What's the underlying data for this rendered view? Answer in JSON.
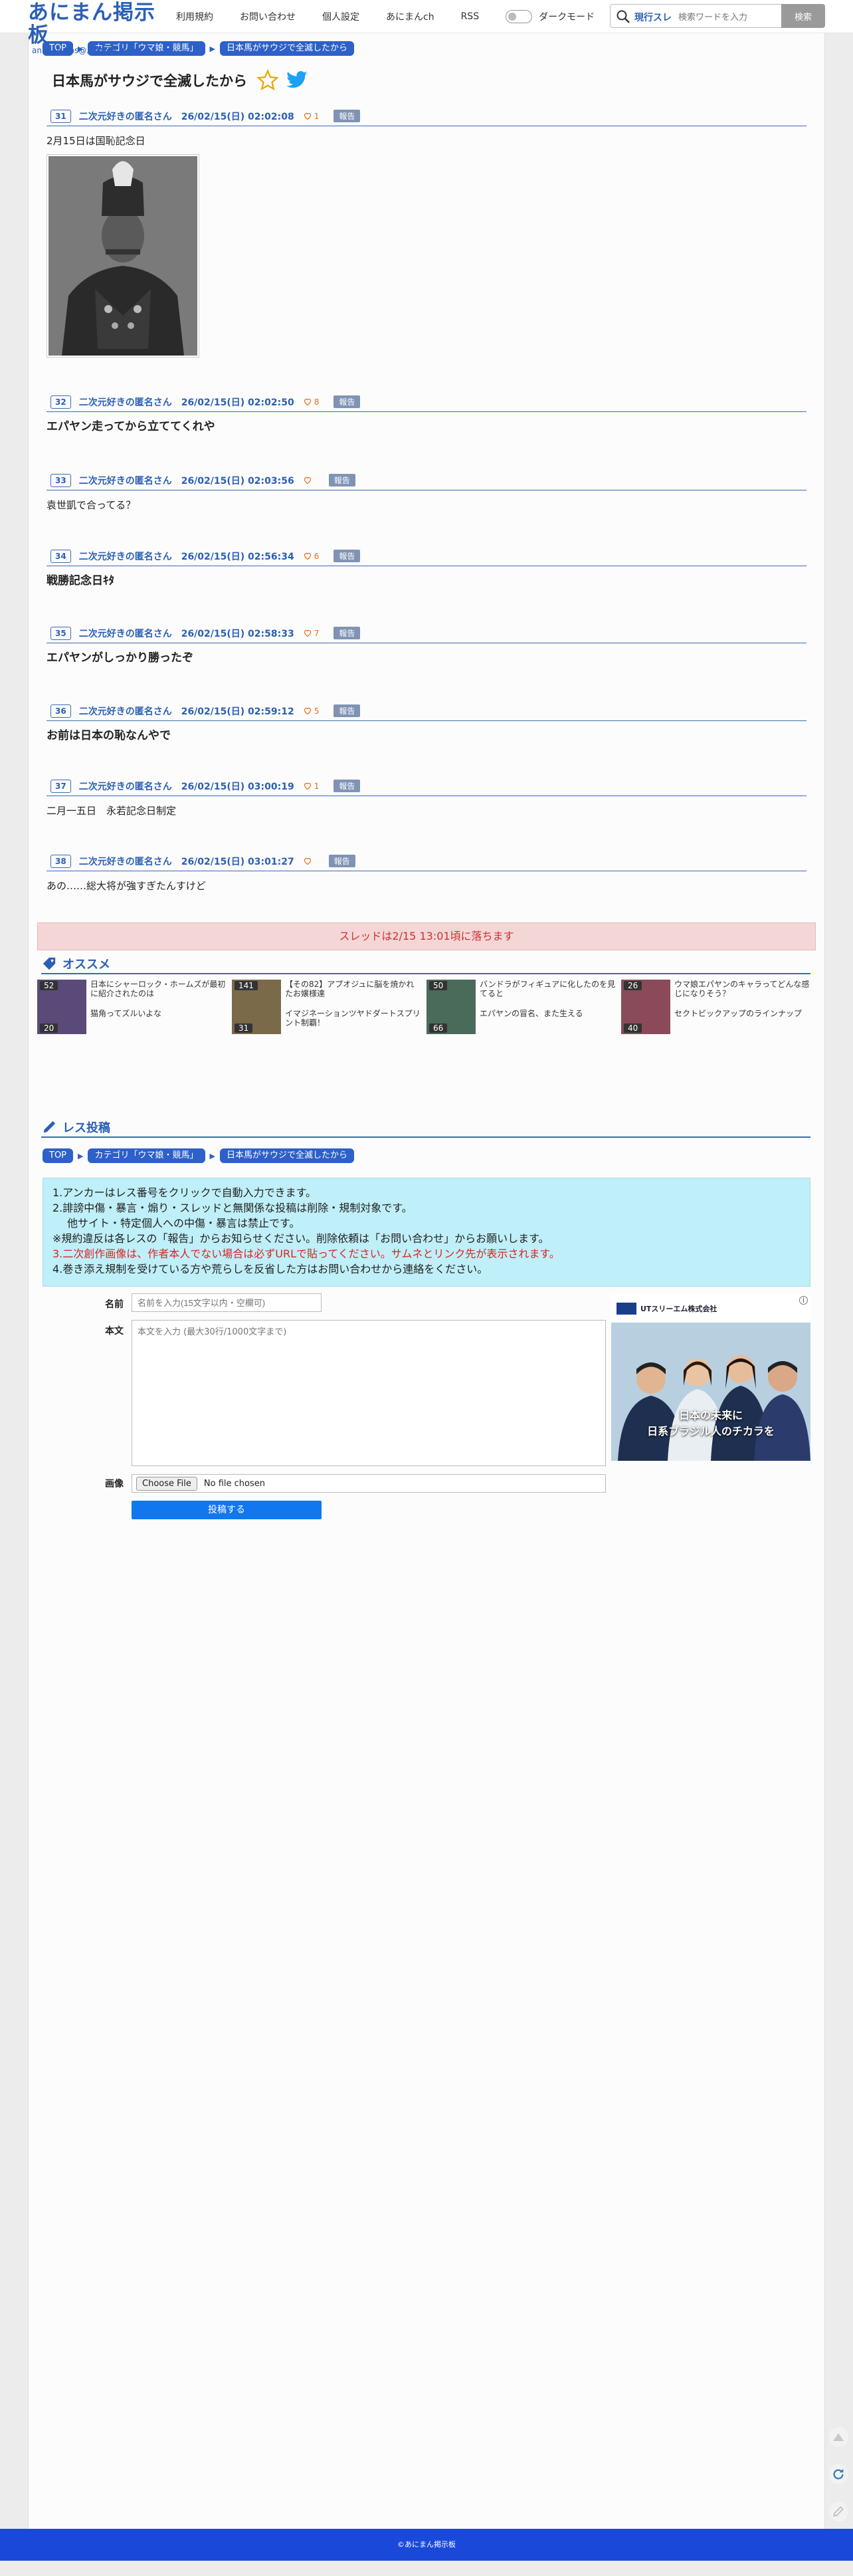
{
  "header": {
    "logo_main": "あにまん掲示板",
    "logo_sub": "animan bbs@二次元オンリー",
    "nav": [
      "利用規約",
      "お問い合わせ",
      "個人設定",
      "あにまんch",
      "RSS"
    ],
    "dark_mode_label": "ダークモード",
    "search_mode": "現行スレ",
    "search_placeholder": "検索ワードを入力",
    "search_button": "検索"
  },
  "breadcrumb": {
    "top": "TOP",
    "category": "カテゴリ「ウマ娘・競馬」",
    "thread": "日本馬がサウジで全滅したから"
  },
  "thread": {
    "title": "日本馬がサウジで全滅したから"
  },
  "posts": [
    {
      "no": "31",
      "name": "二次元好きの匿名さん",
      "date": "26/02/15(日) 02:02:08",
      "likes": "1",
      "report": "報告",
      "body": "2月15日は国恥記念日",
      "has_image": true
    },
    {
      "no": "32",
      "name": "二次元好きの匿名さん",
      "date": "26/02/15(日) 02:02:50",
      "likes": "8",
      "report": "報告",
      "body": "エパヤン走ってから立ててくれや"
    },
    {
      "no": "33",
      "name": "二次元好きの匿名さん",
      "date": "26/02/15(日) 02:03:56",
      "likes": "",
      "report": "報告",
      "body": "袁世凱で合ってる？"
    },
    {
      "no": "34",
      "name": "二次元好きの匿名さん",
      "date": "26/02/15(日) 02:56:34",
      "likes": "6",
      "report": "報告",
      "body": "戦勝記念日ｷﾀ"
    },
    {
      "no": "35",
      "name": "二次元好きの匿名さん",
      "date": "26/02/15(日) 02:58:33",
      "likes": "7",
      "report": "報告",
      "body": "エパヤンがしっかり勝ったぞ"
    },
    {
      "no": "36",
      "name": "二次元好きの匿名さん",
      "date": "26/02/15(日) 02:59:12",
      "likes": "5",
      "report": "報告",
      "body": "お前は日本の恥なんやで"
    },
    {
      "no": "37",
      "name": "二次元好きの匿名さん",
      "date": "26/02/15(日) 03:00:19",
      "likes": "1",
      "report": "報告",
      "body": "二月一五日　永若記念日制定"
    },
    {
      "no": "38",
      "name": "二次元好きの匿名さん",
      "date": "26/02/15(日) 03:01:27",
      "likes": "",
      "report": "報告",
      "body": "あの……総大将が強すぎたんすけど"
    }
  ],
  "drop_notice": "スレッドは2/15 13:01頃に落ちます",
  "recommend": {
    "heading": "オススメ",
    "items": [
      {
        "title": "日本にシャーロック・ホームズが最初に紹介されたのは",
        "sub": "猫角ってズルいよな",
        "count": "20",
        "top_count": "52",
        "color": "#5a4a7a"
      },
      {
        "title": "【その82】アプオジュに脳を焼かれたお嬢様達",
        "sub": "イマジネーションツヤドダートスプリント制覇！",
        "count": "31",
        "top_count": "141",
        "color": "#7a6a4a"
      },
      {
        "title": "バンドラがフィギュアに化したのを見てると",
        "sub": "エパヤンの冒名、また生える",
        "count": "66",
        "top_count": "50",
        "color": "#4a6a5a"
      },
      {
        "title": "ウマ娘エパヤンのキャラってどんな感じになりそう？",
        "sub": "セクトビックアップのラインナップ",
        "count": "40",
        "top_count": "26",
        "color": "#8a4a5a"
      }
    ]
  },
  "reply": {
    "heading": "レス投稿",
    "rules": [
      "1.アンカーはレス番号をクリックで自動入力できます。",
      "2.誹謗中傷・暴言・煽り・スレッドと無関係な投稿は削除・規制対象です。",
      "他サイト・特定個人への中傷・暴言は禁止です。",
      "※規約違反は各レスの「報告」からお知らせください。削除依頼は「お問い合わせ」からお願いします。",
      "3.二次創作画像は、作者本人でない場合は必ずURLで貼ってください。サムネとリンク先が表示されます。",
      "4.巻き添え規制を受けている方や荒らしを反省した方はお問い合わせから連絡をください。"
    ],
    "name_label": "名前",
    "name_placeholder": "名前を入力(15文字以内・空欄可)",
    "body_label": "本文",
    "body_placeholder": "本文を入力 (最大30行/1000文字まで)",
    "image_label": "画像",
    "file_button": "Choose File",
    "file_status": "No file chosen",
    "submit": "投稿する"
  },
  "ad": {
    "company": "UTスリーエム株式会社",
    "headline1": "日本の未来に",
    "headline2": "日系ブラジル人のチカラを"
  },
  "footer": "©あにまん掲示板",
  "colors": {
    "brand": "#2b5fb5",
    "footer": "#1a49d9"
  }
}
